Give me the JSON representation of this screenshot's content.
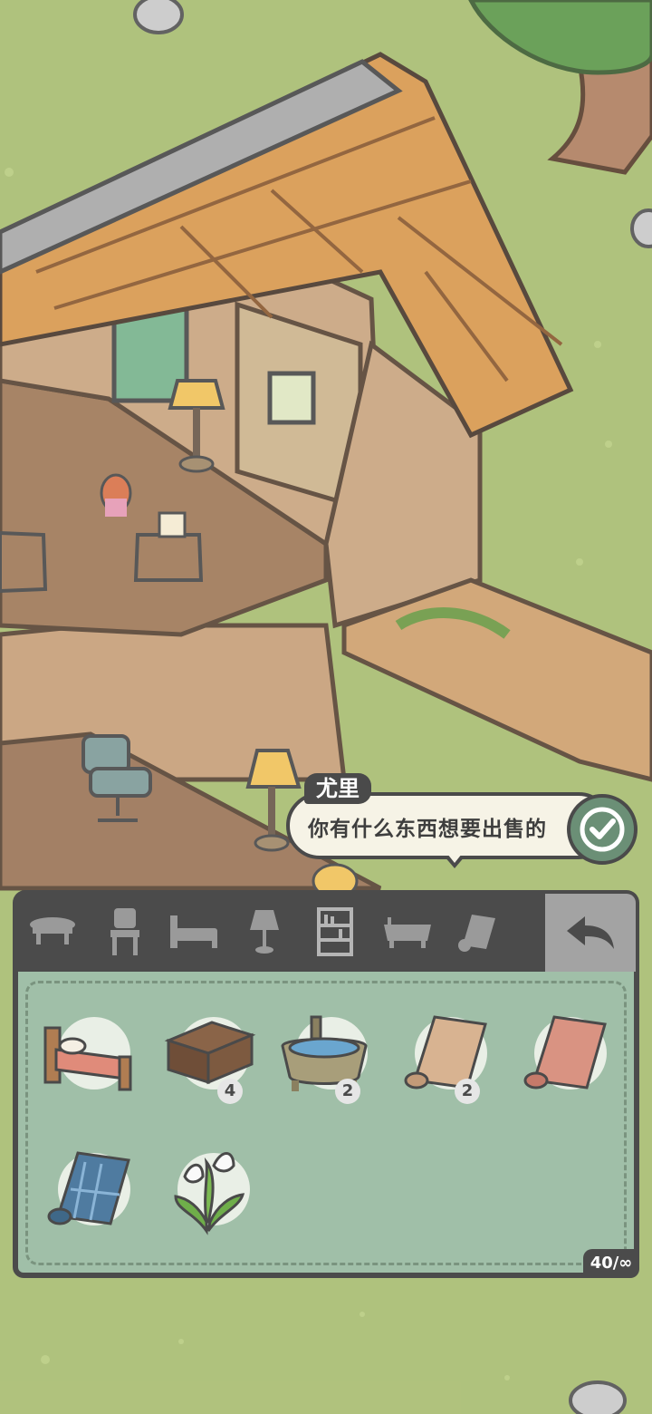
{
  "dialog": {
    "speaker": "尤里",
    "message": "你有什么东西想要出售的"
  },
  "scene": {
    "description_icons": [
      "house-icon",
      "tree-icon",
      "lamp-icon",
      "chair-icon",
      "cat-character-icon",
      "dog-character-icon"
    ]
  },
  "categories": [
    {
      "name": "table-icon"
    },
    {
      "name": "chair-icon"
    },
    {
      "name": "bed-icon"
    },
    {
      "name": "lamp-icon"
    },
    {
      "name": "bookshelf-icon",
      "selected": true
    },
    {
      "name": "bathtub-icon"
    },
    {
      "name": "scroll-icon"
    }
  ],
  "inventory": {
    "items": [
      {
        "name": "bed-item",
        "count": ""
      },
      {
        "name": "chest-item",
        "count": "4"
      },
      {
        "name": "bathtub-item",
        "count": "2"
      },
      {
        "name": "beige-rug-item",
        "count": "2"
      },
      {
        "name": "pink-rug-item",
        "count": ""
      },
      {
        "name": "blue-rug-item",
        "count": ""
      },
      {
        "name": "lily-plant-item",
        "count": ""
      }
    ],
    "capacity": "40/∞"
  },
  "colors": {
    "grass": "#a9bd72",
    "panel": "#a0bfa8",
    "panel_border": "#4b4b4b",
    "back_button": "#a3a3a3",
    "confirm": "#6b8f76"
  }
}
